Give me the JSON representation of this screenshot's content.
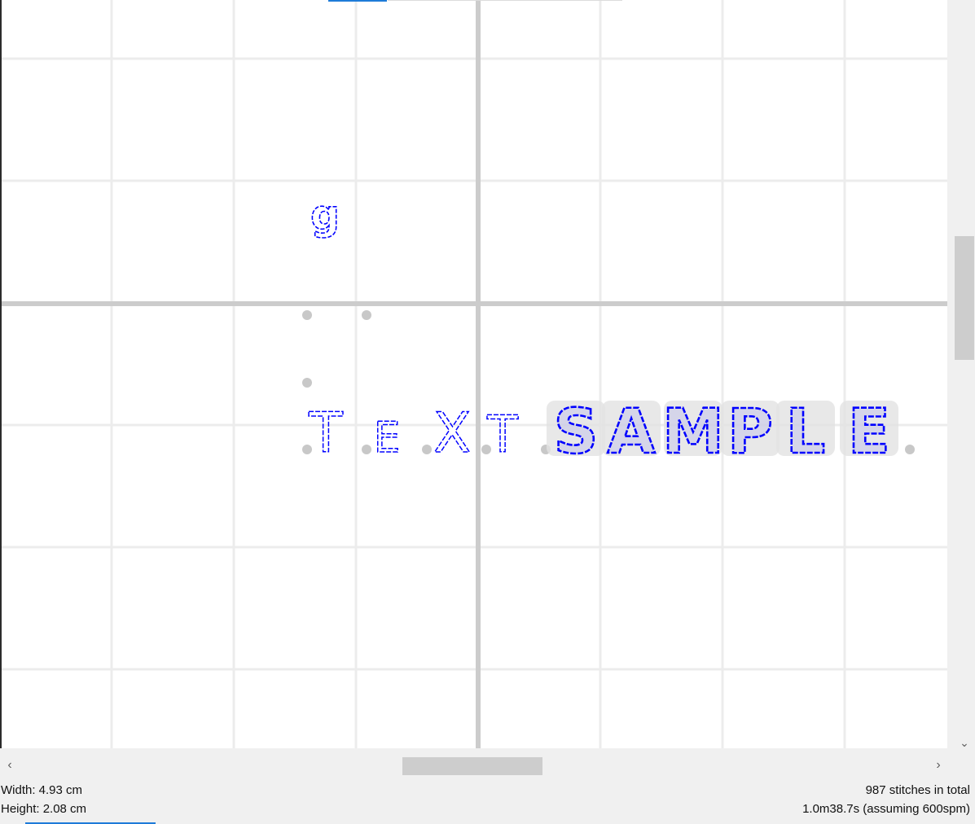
{
  "status": {
    "width": "Width: 4.93 cm",
    "height": "Height: 2.08 cm",
    "stitches": "987 stitches in total",
    "time": "1.0m38.7s (assuming 600spm)"
  },
  "design": {
    "small_glyph": "g",
    "text_letters": [
      "T",
      "E",
      "X",
      "T"
    ],
    "sample_letters": [
      "S",
      "A",
      "M",
      "P",
      "L",
      "E"
    ]
  },
  "colors": {
    "stitch": "#0000ff",
    "grid": "#ececec",
    "axis": "#cccccc",
    "jump_marker": "#c8c8c8"
  },
  "icons": {
    "scroll_left": "chevron-left-icon",
    "scroll_right": "chevron-right-icon",
    "scroll_down": "chevron-down-icon"
  }
}
